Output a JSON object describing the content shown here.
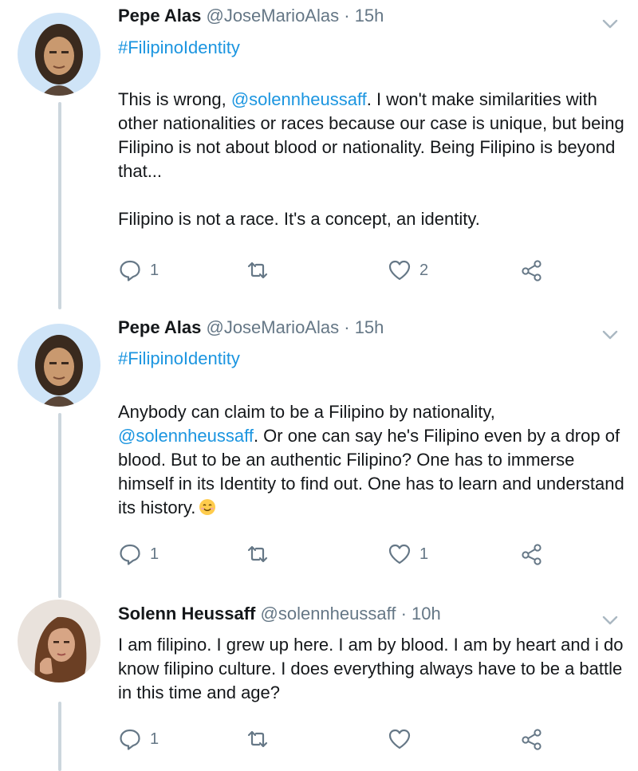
{
  "tweets": [
    {
      "name": "Pepe Alas",
      "handle": "@JoseMarioAlas",
      "separator": "·",
      "time": "15h",
      "hashtag": "#FilipinoIdentity",
      "paragraph1_before": "This is wrong, ",
      "paragraph1_mention": "@solennheussaff",
      "paragraph1_after": ". I won't make similarities with other nationalities or races because our case is unique, but being Filipino is not about blood or nationality. Being Filipino is beyond that...",
      "paragraph2": "Filipino is not a race. It's a concept, an identity.",
      "reply_count": "1",
      "retweet_count": "",
      "like_count": "2"
    },
    {
      "name": "Pepe Alas",
      "handle": "@JoseMarioAlas",
      "separator": "·",
      "time": "15h",
      "hashtag": "#FilipinoIdentity",
      "text_before": "Anybody can claim to be a Filipino by nationality, ",
      "mention": "@solennheussaff",
      "text_after": ". Or one can say he's Filipino even by a drop of blood. But to be an authentic Filipino? One has to immerse himself in its Identity to find out. One has to learn and understand its history.",
      "emoji": "smiling-face-emoji",
      "reply_count": "1",
      "retweet_count": "",
      "like_count": "1"
    },
    {
      "name": "Solenn Heussaff",
      "handle": "@solennheussaff",
      "separator": "·",
      "time": "10h",
      "text": "I am filipino. I grew up here. I  am by blood. I am by heart and i do know filipino culture. I does everything always have to be a battle in this time and age?",
      "reply_count": "1",
      "retweet_count": "",
      "like_count": ""
    }
  ],
  "icons": {
    "reply": "reply-icon",
    "retweet": "retweet-icon",
    "like": "heart-icon",
    "share": "share-icon",
    "more": "chevron-down-icon"
  },
  "colors": {
    "text": "#14171a",
    "secondary": "#657786",
    "link": "#1b95e0",
    "thread_line": "#ccd6dd"
  }
}
